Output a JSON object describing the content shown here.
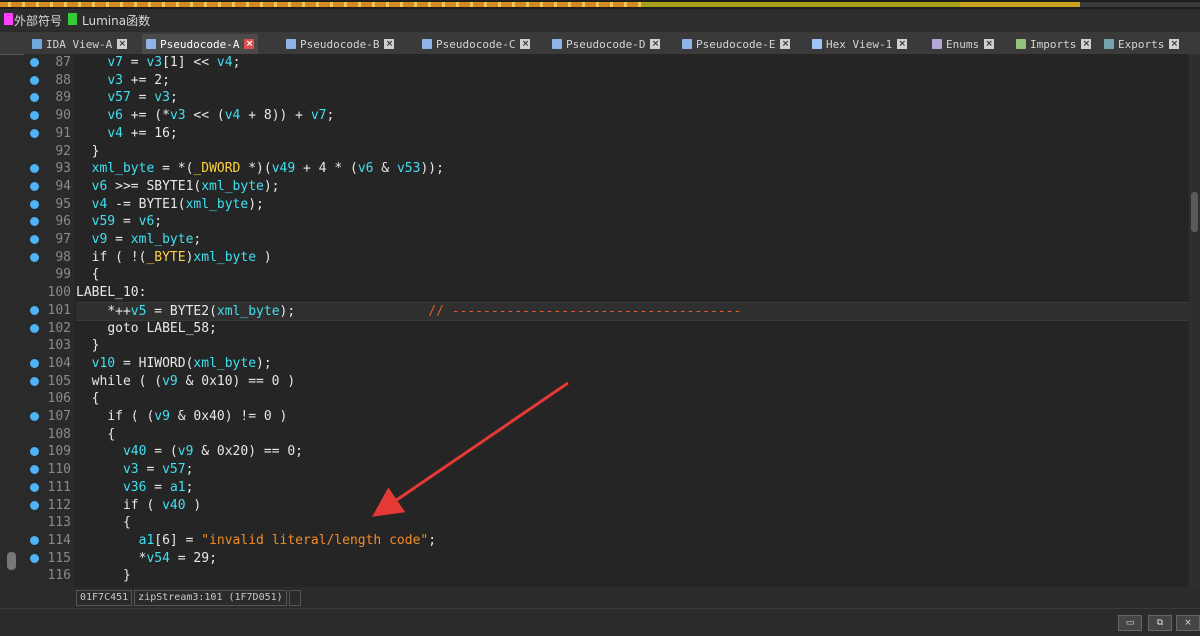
{
  "legend": {
    "items": [
      {
        "label": "外部符号",
        "color": "#ff40ff"
      },
      {
        "label": "Lumina函数",
        "color": "#33cc33"
      }
    ]
  },
  "tabs": [
    {
      "label": "IDA View-A",
      "icon": "ida-view-icon",
      "active": false
    },
    {
      "label": "Pseudocode-A",
      "icon": "pseudocode-icon",
      "active": true
    },
    {
      "label": "Pseudocode-B",
      "icon": "pseudocode-icon",
      "active": false
    },
    {
      "label": "Pseudocode-C",
      "icon": "pseudocode-icon",
      "active": false
    },
    {
      "label": "Pseudocode-D",
      "icon": "pseudocode-icon",
      "active": false
    },
    {
      "label": "Pseudocode-E",
      "icon": "pseudocode-icon",
      "active": false
    },
    {
      "label": "Hex View-1",
      "icon": "hex-view-icon",
      "active": false
    },
    {
      "label": "Enums",
      "icon": "enums-icon",
      "active": false
    },
    {
      "label": "Imports",
      "icon": "imports-icon",
      "active": false
    },
    {
      "label": "Exports",
      "icon": "exports-icon",
      "active": false
    }
  ],
  "tab_close_glyph": "×",
  "left_close_glyph": "×",
  "code": [
    {
      "n": "87",
      "dot": true,
      "indent": "    ",
      "toks": [
        [
          "var",
          "v7"
        ],
        [
          "def",
          " = "
        ],
        [
          "var",
          "v3"
        ],
        [
          "def",
          "[1] << "
        ],
        [
          "var",
          "v4"
        ],
        [
          "def",
          ";"
        ]
      ]
    },
    {
      "n": "88",
      "dot": true,
      "indent": "    ",
      "toks": [
        [
          "var",
          "v3"
        ],
        [
          "def",
          " += 2;"
        ]
      ]
    },
    {
      "n": "89",
      "dot": true,
      "indent": "    ",
      "toks": [
        [
          "var",
          "v57"
        ],
        [
          "def",
          " = "
        ],
        [
          "var",
          "v3"
        ],
        [
          "def",
          ";"
        ]
      ]
    },
    {
      "n": "90",
      "dot": true,
      "indent": "    ",
      "toks": [
        [
          "var",
          "v6"
        ],
        [
          "def",
          " += (*"
        ],
        [
          "var",
          "v3"
        ],
        [
          "def",
          " << ("
        ],
        [
          "var",
          "v4"
        ],
        [
          "def",
          " + 8)) + "
        ],
        [
          "var",
          "v7"
        ],
        [
          "def",
          ";"
        ]
      ]
    },
    {
      "n": "91",
      "dot": true,
      "indent": "    ",
      "toks": [
        [
          "var",
          "v4"
        ],
        [
          "def",
          " += 16;"
        ]
      ]
    },
    {
      "n": "92",
      "dot": false,
      "indent": "  ",
      "toks": [
        [
          "def",
          "}"
        ]
      ]
    },
    {
      "n": "93",
      "dot": true,
      "indent": "  ",
      "toks": [
        [
          "var",
          "xml_byte"
        ],
        [
          "def",
          " = *("
        ],
        [
          "type",
          "_DWORD"
        ],
        [
          "def",
          " *)("
        ],
        [
          "var",
          "v49"
        ],
        [
          "def",
          " + 4 * ("
        ],
        [
          "var",
          "v6"
        ],
        [
          "def",
          " & "
        ],
        [
          "var",
          "v53"
        ],
        [
          "def",
          "));"
        ]
      ]
    },
    {
      "n": "94",
      "dot": true,
      "indent": "  ",
      "toks": [
        [
          "var",
          "v6"
        ],
        [
          "def",
          " >>= SBYTE1("
        ],
        [
          "var",
          "xml_byte"
        ],
        [
          "def",
          ");"
        ]
      ]
    },
    {
      "n": "95",
      "dot": true,
      "indent": "  ",
      "toks": [
        [
          "var",
          "v4"
        ],
        [
          "def",
          " -= BYTE1("
        ],
        [
          "var",
          "xml_byte"
        ],
        [
          "def",
          ");"
        ]
      ]
    },
    {
      "n": "96",
      "dot": true,
      "indent": "  ",
      "toks": [
        [
          "var",
          "v59"
        ],
        [
          "def",
          " = "
        ],
        [
          "var",
          "v6"
        ],
        [
          "def",
          ";"
        ]
      ]
    },
    {
      "n": "97",
      "dot": true,
      "indent": "  ",
      "toks": [
        [
          "var",
          "v9"
        ],
        [
          "def",
          " = "
        ],
        [
          "var",
          "xml_byte"
        ],
        [
          "def",
          ";"
        ]
      ]
    },
    {
      "n": "98",
      "dot": true,
      "indent": "  ",
      "toks": [
        [
          "def",
          "if ( !("
        ],
        [
          "type",
          "_BYTE"
        ],
        [
          "def",
          ")"
        ],
        [
          "var",
          "xml_byte"
        ],
        [
          "def",
          " )"
        ]
      ]
    },
    {
      "n": "99",
      "dot": false,
      "indent": "  ",
      "toks": [
        [
          "def",
          "{"
        ]
      ]
    },
    {
      "n": "100",
      "dot": false,
      "indent": "",
      "toks": [
        [
          "def",
          "LABEL_10:"
        ]
      ]
    },
    {
      "n": "101",
      "dot": true,
      "indent": "    ",
      "cur": true,
      "toks": [
        [
          "def",
          "*++"
        ],
        [
          "var",
          "v5"
        ],
        [
          "def",
          " = BYTE2("
        ],
        [
          "var",
          "xml_byte"
        ],
        [
          "def",
          ");                 "
        ],
        [
          "cmt",
          "// -------------------------------------"
        ]
      ]
    },
    {
      "n": "102",
      "dot": true,
      "indent": "    ",
      "toks": [
        [
          "def",
          "goto LABEL_58;"
        ]
      ]
    },
    {
      "n": "103",
      "dot": false,
      "indent": "  ",
      "toks": [
        [
          "def",
          "}"
        ]
      ]
    },
    {
      "n": "104",
      "dot": true,
      "indent": "  ",
      "toks": [
        [
          "var",
          "v10"
        ],
        [
          "def",
          " = HIWORD("
        ],
        [
          "var",
          "xml_byte"
        ],
        [
          "def",
          ");"
        ]
      ]
    },
    {
      "n": "105",
      "dot": true,
      "indent": "  ",
      "toks": [
        [
          "def",
          "while ( ("
        ],
        [
          "var",
          "v9"
        ],
        [
          "def",
          " & 0x10) == 0 )"
        ]
      ]
    },
    {
      "n": "106",
      "dot": false,
      "indent": "  ",
      "toks": [
        [
          "def",
          "{"
        ]
      ]
    },
    {
      "n": "107",
      "dot": true,
      "indent": "    ",
      "toks": [
        [
          "def",
          "if ( ("
        ],
        [
          "var",
          "v9"
        ],
        [
          "def",
          " & 0x40) != 0 )"
        ]
      ]
    },
    {
      "n": "108",
      "dot": false,
      "indent": "    ",
      "toks": [
        [
          "def",
          "{"
        ]
      ]
    },
    {
      "n": "109",
      "dot": true,
      "indent": "      ",
      "toks": [
        [
          "var",
          "v40"
        ],
        [
          "def",
          " = ("
        ],
        [
          "var",
          "v9"
        ],
        [
          "def",
          " & 0x20) == 0;"
        ]
      ]
    },
    {
      "n": "110",
      "dot": true,
      "indent": "      ",
      "toks": [
        [
          "var",
          "v3"
        ],
        [
          "def",
          " = "
        ],
        [
          "var",
          "v57"
        ],
        [
          "def",
          ";"
        ]
      ]
    },
    {
      "n": "111",
      "dot": true,
      "indent": "      ",
      "toks": [
        [
          "var",
          "v36"
        ],
        [
          "def",
          " = "
        ],
        [
          "var",
          "a1"
        ],
        [
          "def",
          ";"
        ]
      ]
    },
    {
      "n": "112",
      "dot": true,
      "indent": "      ",
      "toks": [
        [
          "def",
          "if ( "
        ],
        [
          "var",
          "v40"
        ],
        [
          "def",
          " )"
        ]
      ]
    },
    {
      "n": "113",
      "dot": false,
      "indent": "      ",
      "toks": [
        [
          "def",
          "{"
        ]
      ]
    },
    {
      "n": "114",
      "dot": true,
      "indent": "        ",
      "toks": [
        [
          "var",
          "a1"
        ],
        [
          "def",
          "[6] = "
        ],
        [
          "str",
          "\"invalid literal/length code\""
        ],
        [
          "def",
          ";"
        ]
      ]
    },
    {
      "n": "115",
      "dot": true,
      "indent": "        ",
      "toks": [
        [
          "def",
          "*"
        ],
        [
          "var",
          "v54"
        ],
        [
          "def",
          " = 29;"
        ]
      ]
    },
    {
      "n": "116",
      "dot": false,
      "indent": "      ",
      "toks": [
        [
          "def",
          "}"
        ]
      ]
    }
  ],
  "status": {
    "address": "01F7C451",
    "location": "zipStream3:101 (1F7D051)",
    "extra": ""
  },
  "window_buttons": [
    {
      "name": "minimize-button",
      "glyph": "▭"
    },
    {
      "name": "restore-button",
      "glyph": "⧉"
    },
    {
      "name": "close-window-button",
      "glyph": "×"
    }
  ],
  "colors": {
    "accent_dot": "#4fb3f5",
    "annotation_arrow": "#e53935"
  }
}
